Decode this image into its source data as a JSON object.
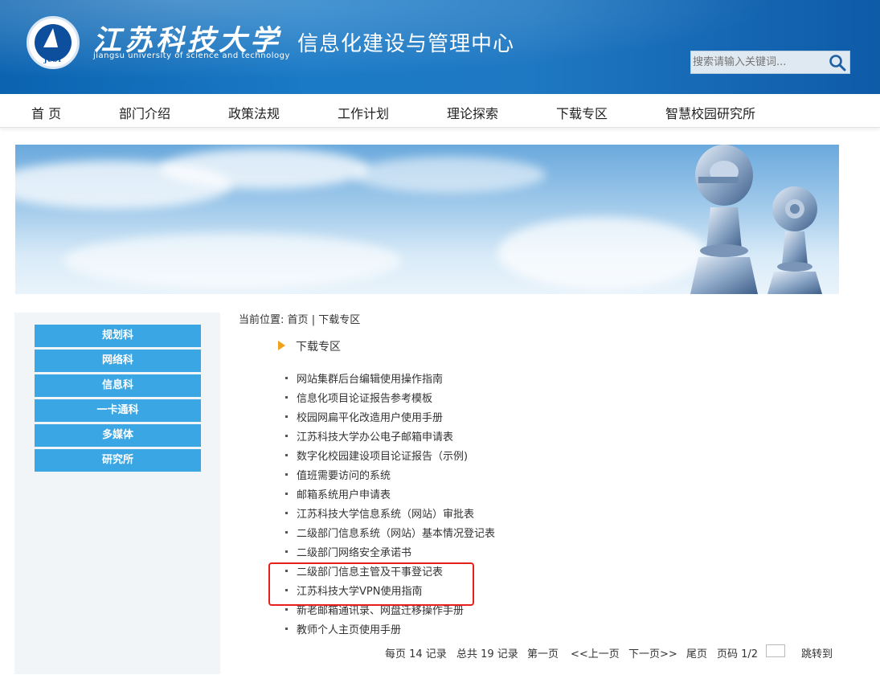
{
  "header": {
    "logo_seal_text": "JUST",
    "brand_cn": "江苏科技大学",
    "brand_en": "jiangsu university of science and technology",
    "site_title": "信息化建设与管理中心",
    "search": {
      "placeholder": "搜索请输入关键词..."
    }
  },
  "nav": {
    "items": [
      "首 页",
      "部门介绍",
      "政策法规",
      "工作计划",
      "理论探索",
      "下载专区",
      "智慧校园研究所"
    ]
  },
  "sidebar": {
    "items": [
      "规划科",
      "网络科",
      "信息科",
      "一卡通科",
      "多媒体",
      "研究所"
    ]
  },
  "breadcrumb": {
    "prefix": "当前位置:",
    "home": "首页",
    "sep": "|",
    "current": "下载专区"
  },
  "section": {
    "title": "下载专区"
  },
  "downloads": [
    "网站集群后台编辑使用操作指南",
    "信息化项目论证报告参考模板",
    "校园网扁平化改造用户使用手册",
    "江苏科技大学办公电子邮箱申请表",
    "数字化校园建设项目论证报告（示例)",
    "值班需要访问的系统",
    "邮箱系统用户申请表",
    "江苏科技大学信息系统（网站）审批表",
    "二级部门信息系统（网站）基本情况登记表",
    "二级部门网络安全承诺书",
    "二级部门信息主管及干事登记表",
    "江苏科技大学VPN使用指南",
    "新老邮箱通讯录、网盘迁移操作手册",
    "教师个人主页使用手册"
  ],
  "pagination": {
    "per_page": "每页 14 记录",
    "total": "总共 19 记录",
    "first": "第一页",
    "prev": "<<上一页",
    "next": "下一页>>",
    "last": "尾页",
    "page_info": "页码 1/2",
    "jump": "跳转到"
  },
  "colors": {
    "header_blue": "#1a7ac6",
    "sidebar_button": "#3aa6e4",
    "highlight_red": "#e8201b",
    "section_arrow": "#f0a21b"
  }
}
